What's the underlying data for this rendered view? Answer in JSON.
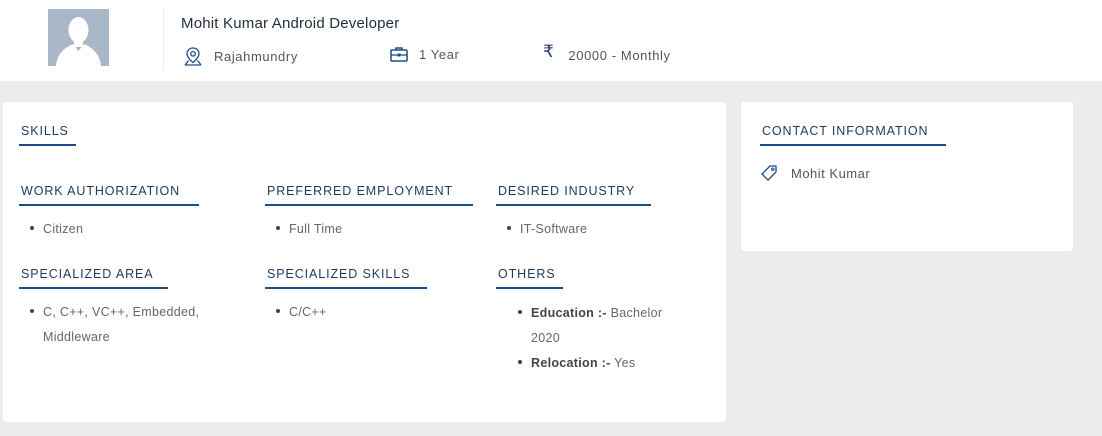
{
  "profile": {
    "name": "Mohit Kumar Android Developer",
    "location": "Rajahmundry",
    "experience": "1 Year",
    "salary_symbol": "₹",
    "salary": "20000 - Monthly"
  },
  "skills_title": "SKILLS",
  "sections": {
    "work_auth": {
      "title": "WORK AUTHORIZATION",
      "items": [
        "Citizen"
      ]
    },
    "pref_emp": {
      "title": "PREFERRED EMPLOYMENT",
      "items": [
        "Full Time"
      ]
    },
    "desired_industry": {
      "title": "DESIRED INDUSTRY",
      "items": [
        "IT-Software"
      ]
    },
    "spec_area": {
      "title": "SPECIALIZED AREA",
      "line1": "C, C++, VC++, Embedded,",
      "line2": "Middleware"
    },
    "spec_skills": {
      "title": "SPECIALIZED SKILLS",
      "items": [
        "C/C++"
      ]
    },
    "others": {
      "title": "OTHERS",
      "education_label": "Education :-",
      "education_value_1": "Bachelor",
      "education_value_2": "2020",
      "relocation_label": "Relocation :-",
      "relocation_value": "Yes"
    }
  },
  "contact": {
    "title": "CONTACT INFORMATION",
    "name": "Mohit Kumar"
  },
  "icons": {
    "location": "location-pin-icon",
    "experience": "briefcase-icon",
    "salary": "rupee-icon",
    "contact": "tag-icon"
  },
  "colors": {
    "accent": "#1e4c86",
    "heading": "#1e3a5f",
    "background": "#ececec",
    "avatar": "#a9b8c8"
  }
}
